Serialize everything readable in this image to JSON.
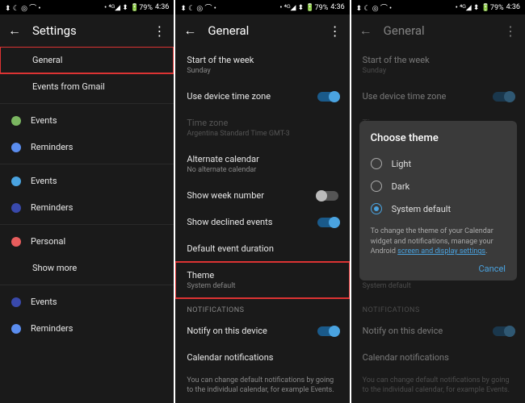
{
  "status": {
    "left_icons": "⬍ ☾ ◎ ⌒ •",
    "right_icons": "• ⁴ᴳ◢ ⬍ 🔋79%",
    "time": "4:36"
  },
  "panel1": {
    "title": "Settings",
    "items": {
      "general": "General",
      "gmail": "Events from Gmail",
      "events1": "Events",
      "reminders1": "Reminders",
      "events2": "Events",
      "reminders2": "Reminders",
      "personal": "Personal",
      "showmore": "Show more",
      "events3": "Events",
      "reminders3": "Reminders"
    },
    "colors": {
      "events1": "#7bb661",
      "reminders1": "#5b8def",
      "events2": "#4aa3e0",
      "reminders2": "#3949ab",
      "personal": "#e85d5d",
      "events3": "#3949ab",
      "reminders3": "#5b8def"
    }
  },
  "panel2": {
    "title": "General",
    "start_week": {
      "t": "Start of the week",
      "s": "Sunday"
    },
    "device_tz": {
      "t": "Use device time zone"
    },
    "timezone": {
      "t": "Time zone",
      "s": "Argentina Standard Time  GMT-3"
    },
    "alt_cal": {
      "t": "Alternate calendar",
      "s": "No alternate calendar"
    },
    "weeknum": {
      "t": "Show week number"
    },
    "declined": {
      "t": "Show declined events"
    },
    "duration": {
      "t": "Default event duration"
    },
    "theme": {
      "t": "Theme",
      "s": "System default"
    },
    "section_notif": "NOTIFICATIONS",
    "notify": {
      "t": "Notify on this device"
    },
    "cal_notif": {
      "t": "Calendar notifications"
    },
    "foot": "You can change default notifications by going to the individual calendar, for example Events."
  },
  "dialog": {
    "title": "Choose theme",
    "opt_light": "Light",
    "opt_dark": "Dark",
    "opt_system": "System default",
    "note_a": "To change the theme of your Calendar widget and notifications, manage your Android ",
    "note_link": "screen and display settings",
    "note_b": ".",
    "cancel": "Cancel"
  }
}
